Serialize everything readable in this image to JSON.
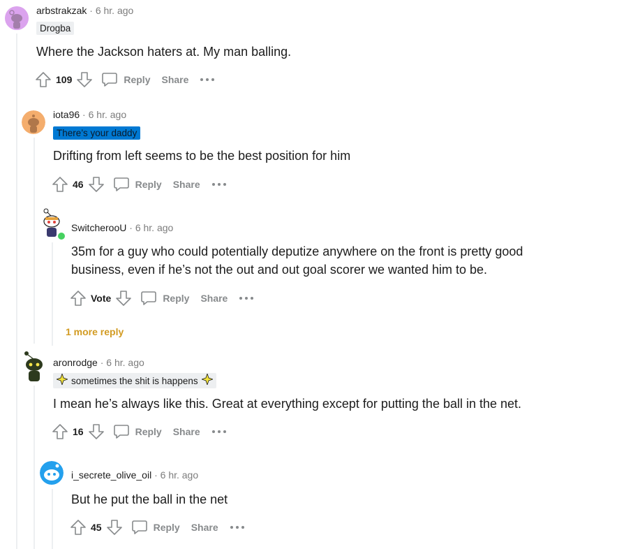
{
  "comments": [
    {
      "username": "arbstrakzak",
      "time": "6 hr. ago",
      "flair": "Drogba",
      "body": "Where the Jackson haters at. My man balling.",
      "score": "109",
      "reply_label": "Reply",
      "share_label": "Share"
    },
    {
      "username": "iota96",
      "time": "6 hr. ago",
      "flair": "There’s your daddy",
      "body": "Drifting from left seems to be the best position for him",
      "score": "46",
      "reply_label": "Reply",
      "share_label": "Share"
    },
    {
      "username": "SwitcherooU",
      "time": "6 hr. ago",
      "body_line1": "35m for a guy who could potentially deputize anywhere on the front is pretty good",
      "body_line2": "business, even if he’s not the out and out goal scorer we wanted him to be.",
      "score": "Vote",
      "reply_label": "Reply",
      "share_label": "Share"
    },
    {
      "username": "aronrodge",
      "time": "6 hr. ago",
      "flair": "sometimes the shit is happens",
      "body": "I mean he’s always like this. Great at everything except for putting the ball in the net.",
      "score": "16",
      "reply_label": "Reply",
      "share_label": "Share"
    },
    {
      "username": "i_secrete_olive_oil",
      "time": "6 hr. ago",
      "body": "But he put the ball in the net",
      "score": "45",
      "reply_label": "Reply",
      "share_label": "Share"
    }
  ],
  "more_replies_label": "1 more reply",
  "dot_separator": "·",
  "colors": {
    "text": "#1c1c1c",
    "muted": "#878a8c",
    "thread_line": "#edeff1",
    "flair_blue": "#0079d3",
    "more_replies": "#d29b22",
    "online": "#46d160"
  }
}
